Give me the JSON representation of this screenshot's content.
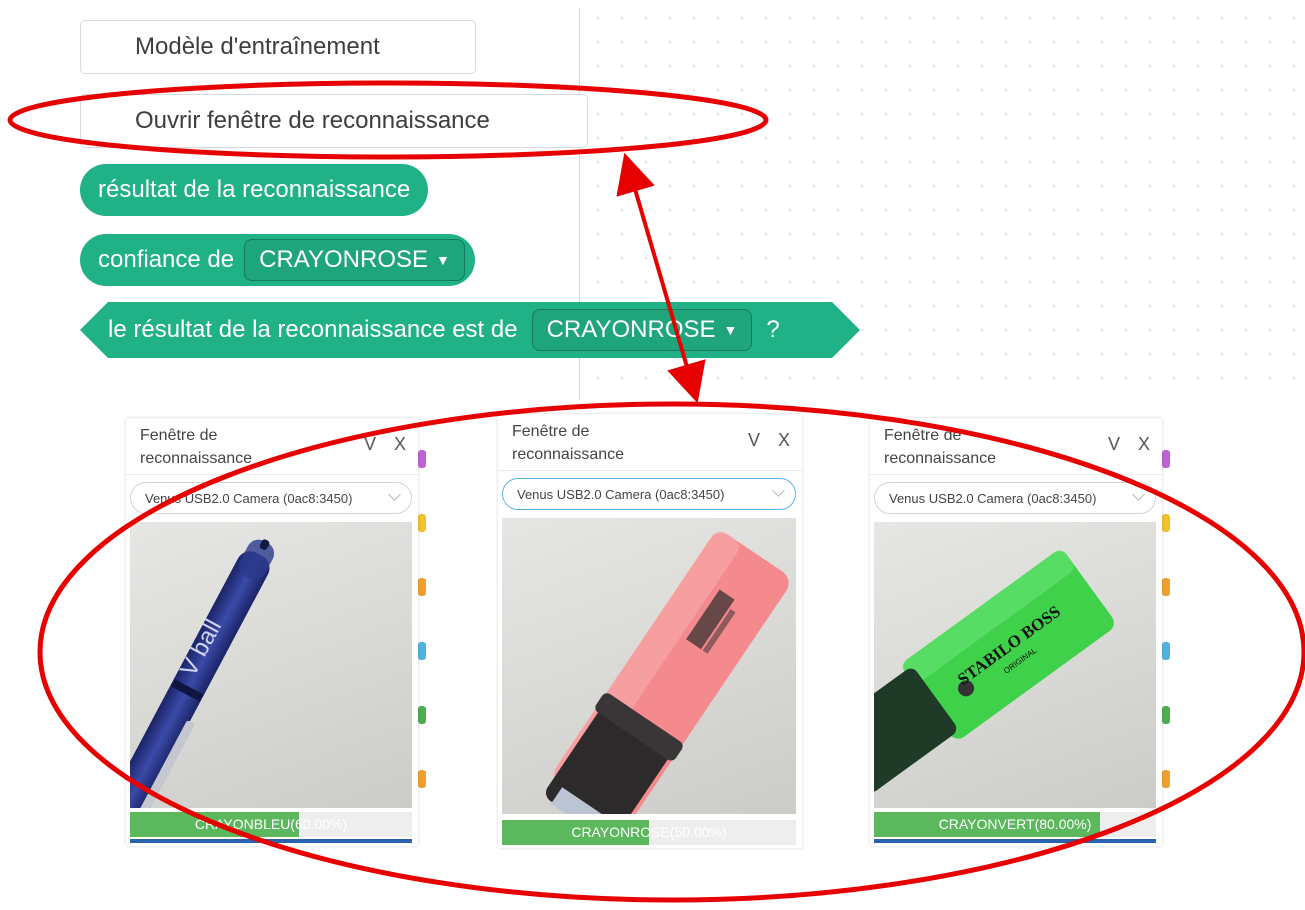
{
  "palette": {
    "train_button": "Modèle d'entraînement",
    "open_window_button": "Ouvrir fenêtre de reconnaissance",
    "result_block": "résultat de la reconnaissance",
    "confidence_block": {
      "label": "confiance de",
      "value": "CRAYONROSE"
    },
    "is_result_block": {
      "label": "le résultat de la reconnaissance est de",
      "value": "CRAYONROSE",
      "suffix": "?"
    }
  },
  "panels": [
    {
      "title": "Fenêtre de reconnaissance",
      "collapse_label": "V",
      "close_label": "X",
      "camera": "Venus USB2.0 Camera (0ac8:3450)",
      "result_label": "CRAYONBLEU(60.00%)",
      "confidence": 0.6,
      "object": "blue pen"
    },
    {
      "title": "Fenêtre de reconnaissance",
      "collapse_label": "V",
      "close_label": "X",
      "camera": "Venus USB2.0 Camera (0ac8:3450)",
      "result_label": "CRAYONROSE(50.00%)",
      "confidence": 0.5,
      "object": "pink highlighter"
    },
    {
      "title": "Fenêtre de reconnaissance",
      "collapse_label": "V",
      "close_label": "X",
      "camera": "Venus USB2.0 Camera (0ac8:3450)",
      "result_label": "CRAYONVERT(80.00%)",
      "confidence": 0.8,
      "object": "green highlighter"
    }
  ],
  "object_labels": {
    "pen_brand": "V ball",
    "green_brand": "STABILO BOSS",
    "green_sub": "ORIGINAL"
  },
  "colors": {
    "block_green": "#21b186",
    "annotation_red": "#e60000",
    "result_green": "#5cb85c",
    "bottom_blue": "#2962b0"
  }
}
